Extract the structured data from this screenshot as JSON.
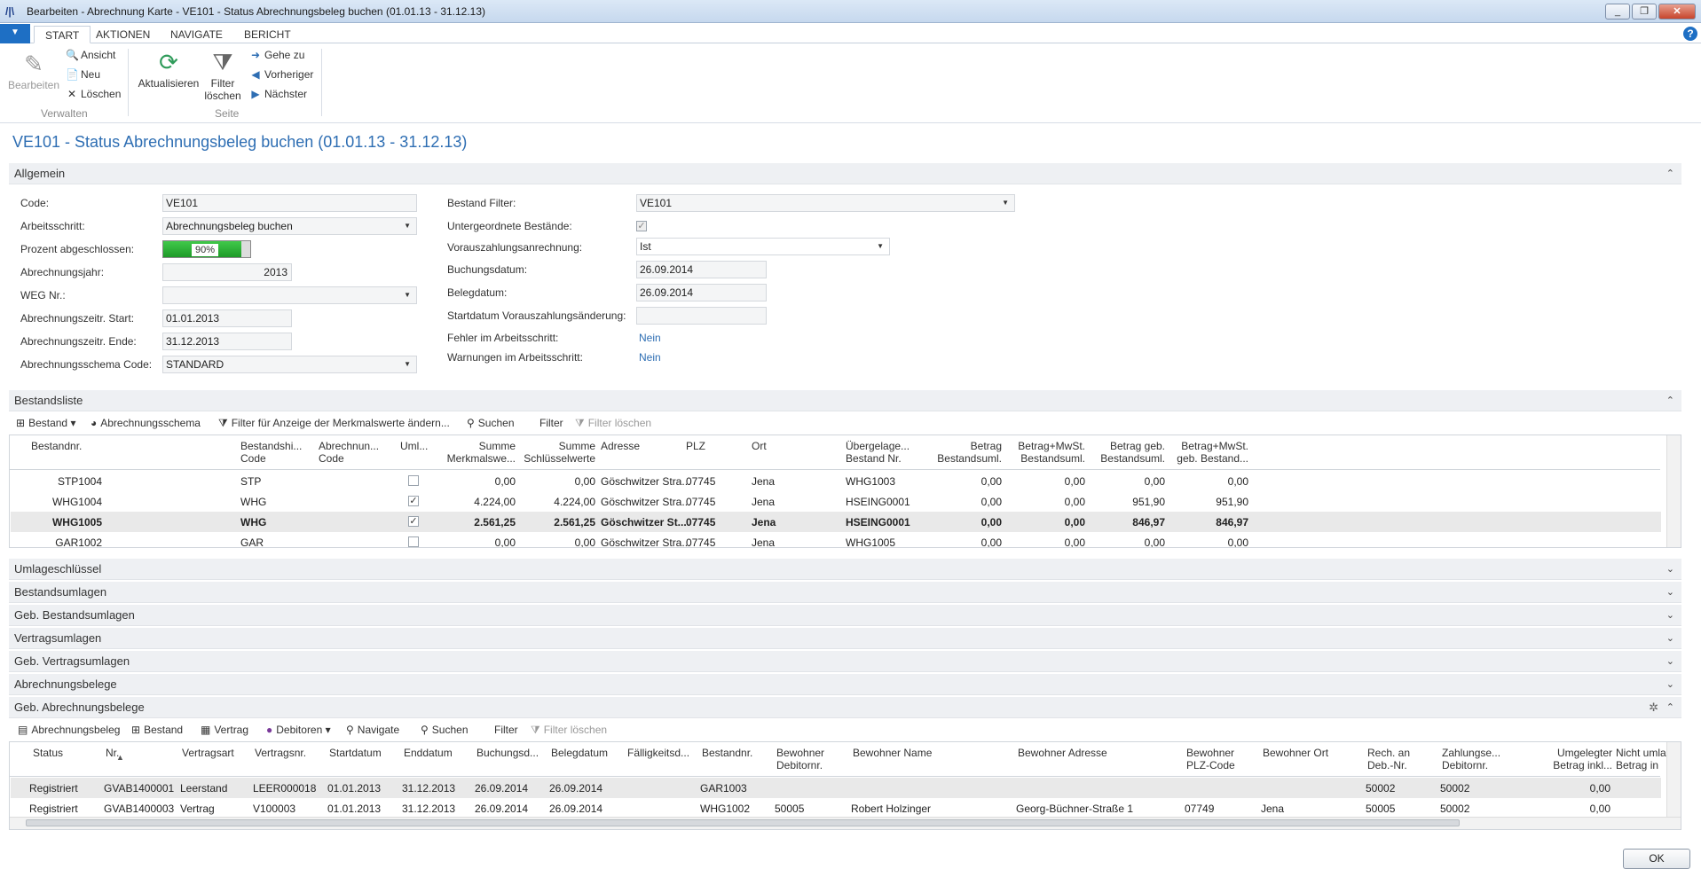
{
  "window": {
    "title": "Bearbeiten - Abrechnung Karte - VE101 - Status Abrechnungsbeleg buchen (01.01.13 - 31.12.13)"
  },
  "menu": {
    "tabs": [
      "START",
      "AKTIONEN",
      "NAVIGATE",
      "BERICHT"
    ]
  },
  "ribbon": {
    "edit": "Bearbeiten",
    "view": "Ansicht",
    "new": "Neu",
    "delete": "Löschen",
    "group_manage": "Verwalten",
    "refresh": "Aktualisieren",
    "clear_filter_1": "Filter",
    "clear_filter_2": "löschen",
    "goto": "Gehe zu",
    "previous": "Vorheriger",
    "next": "Nächster",
    "group_page": "Seite"
  },
  "page": {
    "title": "VE101 - Status Abrechnungsbeleg buchen (01.01.13 - 31.12.13)"
  },
  "general": {
    "section": "Allgemein",
    "code_label": "Code:",
    "code": "VE101",
    "step_label": "Arbeitsschritt:",
    "step": "Abrechnungsbeleg buchen",
    "percent_label": "Prozent abgeschlossen:",
    "percent": "90%",
    "percent_value": 0.9,
    "year_label": "Abrechnungsjahr:",
    "year": "2013",
    "weg_label": "WEG Nr.:",
    "weg": "",
    "start_label": "Abrechnungszeitr. Start:",
    "start": "01.01.2013",
    "end_label": "Abrechnungszeitr. Ende:",
    "end": "31.12.2013",
    "schema_label": "Abrechnungsschema Code:",
    "schema": "STANDARD",
    "bestand_filter_label": "Bestand Filter:",
    "bestand_filter": "VE101",
    "sub_label": "Untergeordnete Bestände:",
    "prepay_label": "Vorauszahlungsanrechnung:",
    "prepay": "Ist",
    "postdate_label": "Buchungsdatum:",
    "postdate": "26.09.2014",
    "docdate_label": "Belegdatum:",
    "docdate": "26.09.2014",
    "startchange_label": "Startdatum Vorauszahlungsänderung:",
    "startchange": "",
    "errors_label": "Fehler im Arbeitsschritt:",
    "errors": "Nein",
    "warnings_label": "Warnungen im Arbeitsschritt:",
    "warnings": "Nein"
  },
  "bestandsliste": {
    "section": "Bestandsliste",
    "actions": [
      "Bestand",
      "Abrechnungsschema",
      "Filter für Anzeige der Merkmalswerte ändern...",
      "Suchen",
      "Filter",
      "Filter löschen"
    ],
    "headers": [
      "Bestandnr.",
      "Bestandshi...\nCode",
      "Abrechnun...\nCode",
      "Uml...",
      "Summe\nMerkmalswe...",
      "Summe\nSchlüsselwerte",
      "Adresse",
      "PLZ",
      "Ort",
      "Übergelage...\nBestand Nr.",
      "Betrag\nBestandsuml.",
      "Betrag+MwSt.\nBestandsuml.",
      "Betrag geb.\nBestandsuml.",
      "Betrag+MwSt.\ngeb. Bestand..."
    ],
    "rows": [
      {
        "nr": "STP1004",
        "code": "STP",
        "abr": "",
        "uml": false,
        "merk": "0,00",
        "schl": "0,00",
        "adr": "Göschwitzer Stra...",
        "plz": "07745",
        "ort": "Jena",
        "ueb": "WHG1003",
        "b1": "0,00",
        "b2": "0,00",
        "b3": "0,00",
        "b4": "0,00",
        "bold": false
      },
      {
        "nr": "WHG1004",
        "code": "WHG",
        "abr": "",
        "uml": true,
        "merk": "4.224,00",
        "schl": "4.224,00",
        "adr": "Göschwitzer Stra...",
        "plz": "07745",
        "ort": "Jena",
        "ueb": "HSEING0001",
        "b1": "0,00",
        "b2": "0,00",
        "b3": "951,90",
        "b4": "951,90",
        "bold": false
      },
      {
        "nr": "WHG1005",
        "code": "WHG",
        "abr": "",
        "uml": true,
        "merk": "2.561,25",
        "schl": "2.561,25",
        "adr": "Göschwitzer St...",
        "plz": "07745",
        "ort": "Jena",
        "ueb": "HSEING0001",
        "b1": "0,00",
        "b2": "0,00",
        "b3": "846,97",
        "b4": "846,97",
        "bold": true
      },
      {
        "nr": "GAR1002",
        "code": "GAR",
        "abr": "",
        "uml": false,
        "merk": "0,00",
        "schl": "0,00",
        "adr": "Göschwitzer Stra...",
        "plz": "07745",
        "ort": "Jena",
        "ueb": "WHG1005",
        "b1": "0,00",
        "b2": "0,00",
        "b3": "0,00",
        "b4": "0,00",
        "bold": false
      }
    ]
  },
  "collapsed_sections": [
    "Umlageschlüssel",
    "Bestandsumlagen",
    "Geb. Bestandsumlagen",
    "Vertragsumlagen",
    "Geb. Vertragsumlagen",
    "Abrechnungsbelege"
  ],
  "belege": {
    "section": "Geb. Abrechnungsbelege",
    "actions": [
      "Abrechnungsbeleg",
      "Bestand",
      "Vertrag",
      "Debitoren",
      "Navigate",
      "Suchen",
      "Filter",
      "Filter löschen"
    ],
    "headers": [
      "Status",
      "Nr.",
      "Vertragsart",
      "Vertragsnr.",
      "Startdatum",
      "Enddatum",
      "Buchungsd...",
      "Belegdatum",
      "Fälligkeitsd...",
      "Bestandnr.",
      "Bewohner\nDebitornr.",
      "Bewohner Name",
      "Bewohner Adresse",
      "Bewohner\nPLZ-Code",
      "Bewohner Ort",
      "Rech. an\nDeb.-Nr.",
      "Zahlungse...\nDebitornr.",
      "Umgelegter\nBetrag inkl...",
      "Nicht umla\nBetrag in"
    ],
    "rows": [
      [
        "Registriert",
        "GVAB1400001",
        "Leerstand",
        "LEER000018",
        "01.01.2013",
        "31.12.2013",
        "26.09.2014",
        "26.09.2014",
        "",
        "GAR1003",
        "",
        "",
        "",
        "",
        "",
        "50002",
        "50002",
        "0,00",
        ""
      ],
      [
        "Registriert",
        "GVAB1400003",
        "Vertrag",
        "V100003",
        "01.01.2013",
        "31.12.2013",
        "26.09.2014",
        "26.09.2014",
        "",
        "WHG1002",
        "50005",
        "Robert Holzinger",
        "Georg-Büchner-Straße 1",
        "07749",
        "Jena",
        "50005",
        "50002",
        "0,00",
        ""
      ]
    ]
  },
  "ok_button": "OK"
}
